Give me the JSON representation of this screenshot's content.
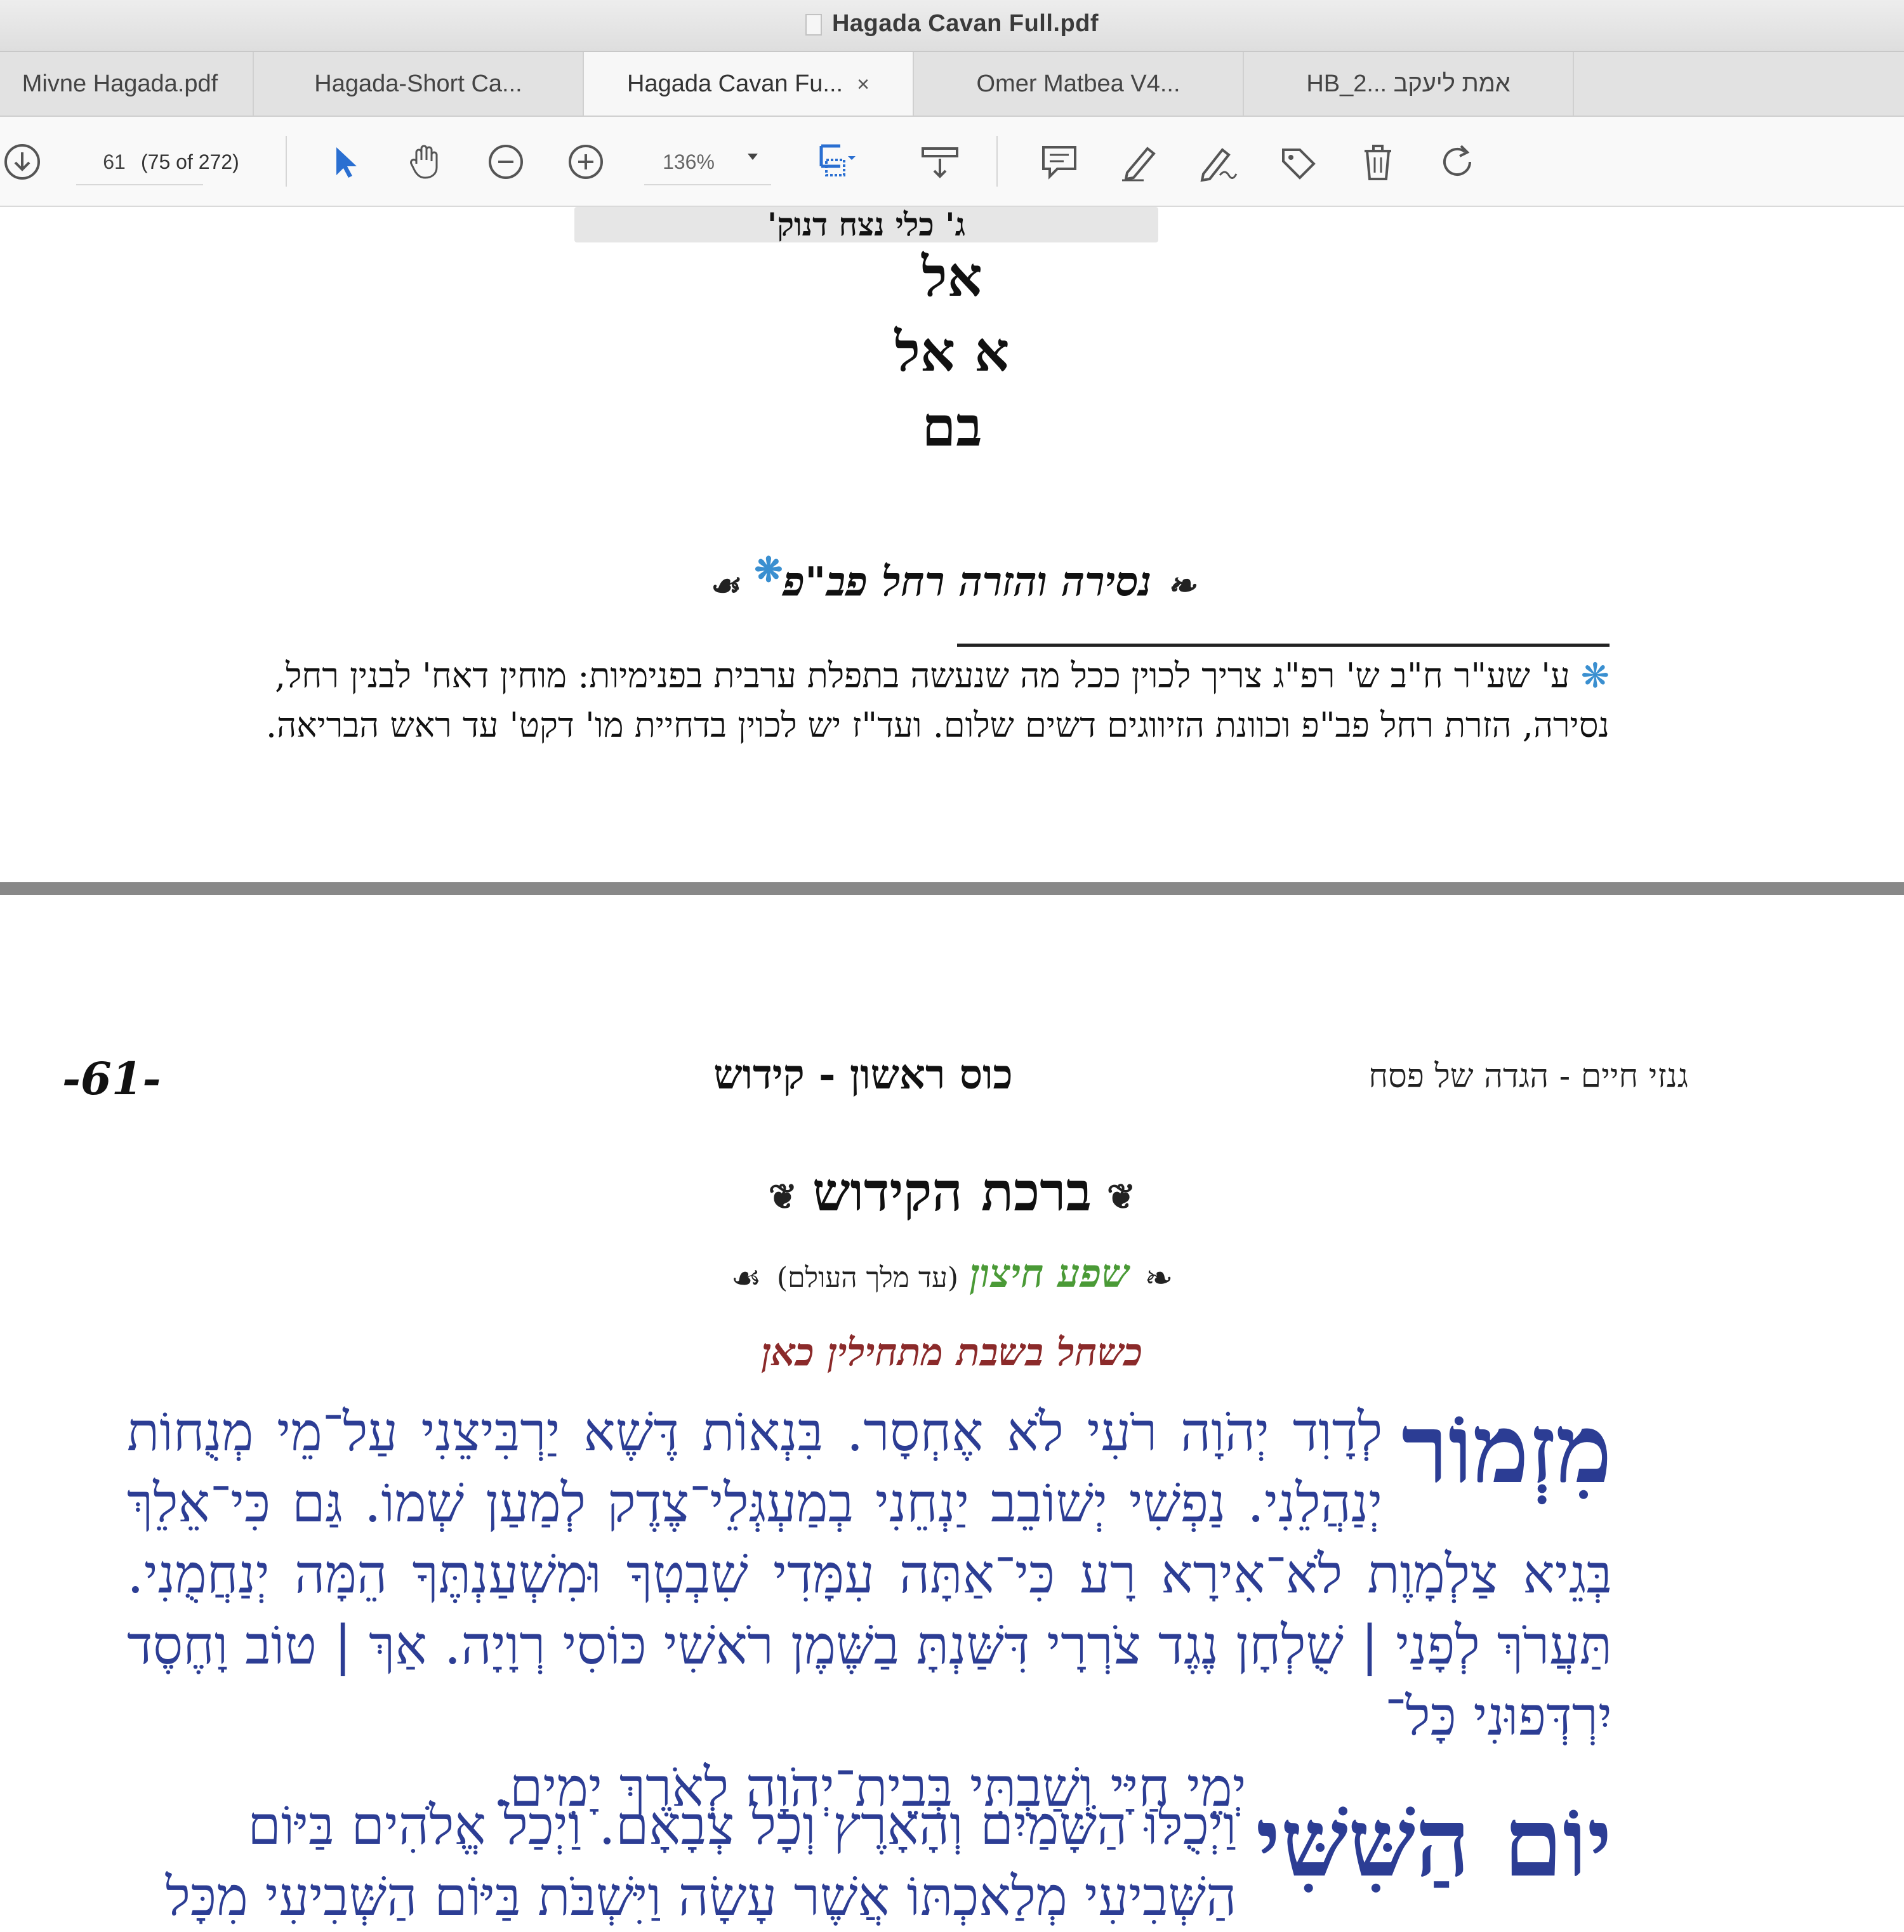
{
  "window": {
    "title": "Hagada Cavan Full.pdf"
  },
  "tabs": [
    {
      "label": "Mivne Hagada.pdf",
      "active": false
    },
    {
      "label": "Hagada-Short Ca...",
      "active": false
    },
    {
      "label": "Hagada Cavan Fu...",
      "active": true,
      "close": "×"
    },
    {
      "label": "Omer Matbea V4...",
      "active": false
    },
    {
      "label": "HB_2... אמת ליעקב",
      "active": false
    }
  ],
  "toolbar": {
    "page_number": "61",
    "page_count": "(75 of 272)",
    "zoom": "136%",
    "icons": [
      "download-icon",
      "select-arrow-icon",
      "hand-tool-icon",
      "zoom-out-icon",
      "zoom-in-icon",
      "fit-page-icon",
      "scroll-mode-icon",
      "comment-icon",
      "highlight-pen-icon",
      "sign-icon",
      "tag-icon",
      "trash-icon",
      "rotate-icon"
    ]
  },
  "page1": {
    "caption": "ג' כלי נצח דנוק'",
    "letters": [
      "אל",
      "א אל",
      "בם"
    ],
    "heading": "נסירה והזרה רחל פב\"פ",
    "heading_star": "❋",
    "note_line1": "ע' שע\"ר ח\"ב ש' רפ\"ג צריך לכוין ככל מה שנעשה בתפלת ערבית בפנימיות: מוחין דאח' לבנין רחל,",
    "note_line2": "נסירה, הזרת רחל פב\"פ וכוונת הזיווגים דשים שלום. ועד\"ז יש לכוין בדחיית מו' דקט' עד ראש הבריאה."
  },
  "page2": {
    "page_number": "-61-",
    "running_head_center": "כוס ראשון - קידוש",
    "running_head_right": "גנזי חיים - הגדה של פסח",
    "title": "ברכת הקידוש",
    "subtitle_green": "שפע חיצון",
    "subtitle_small": "(עד מלך העולם)",
    "instruction": "כשחל בשבת מתחילין כאן",
    "psalm_dropword": "מִזְמוֹר",
    "psalm_lines": [
      "לְדָוִד יְהֹוָה רֹעִי לֹא אֶחְסָר. בִּנְאוֹת דֶּשֶׁא יַרְבִּיצֵנִי עַל־מֵי מְנֻחוֹת",
      "יְנַהֲלֵנִי. נַפְשִׁי יְשׁוֹבֵב יַנְחֵנִי בְמַעְגְּלֵי־צֶדֶק לְמַעַן שְׁמוֹ. גַּם כִּי־אֵלֵךְ",
      "בְּגֵיא צַלְמָוֶת לֹא־אִירָא רָע כִּי־אַתָּה עִמָּדִי שִׁבְטְךָ וּמִשְׁעַנְתֶּךָ הֵמָּה יְנַחֲמֻנִי. תַּעֲרֹךְ",
      "לְפָנַי | שֻׁלְחָן נֶגֶד צֹרְרָי דִּשַּׁנְתָּ בַשֶּׁמֶן רֹאשִׁי כּוֹסִי רְוָיָה. אַךְ | טוֹב וָחֶסֶד יִרְדְּפוּנִי כָּל־",
      "יְמֵי חַיָּי וְשַׁבְתִּי בְּבֵית־יְהֹוָה לְאֹרֶךְ יָמִים."
    ],
    "yom_dropword": "יוֹם הַשִּׁשִּׁי",
    "yom_line1": "וַיְכֻלּוּ הַשָּׁמַיִם וְהָאָרֶץ וְכָל צְבָאָם. וַיְכַל אֱלֹהִים בַּיּוֹם",
    "yom_line2": "הַשְּׁבִיעִי מְלַאכְתּוֹ אֲשֶׁר עָשָׂה וַיִּשְׁבֹּת בַּיּוֹם הַשְּׁבִיעִי מִכָּל"
  }
}
